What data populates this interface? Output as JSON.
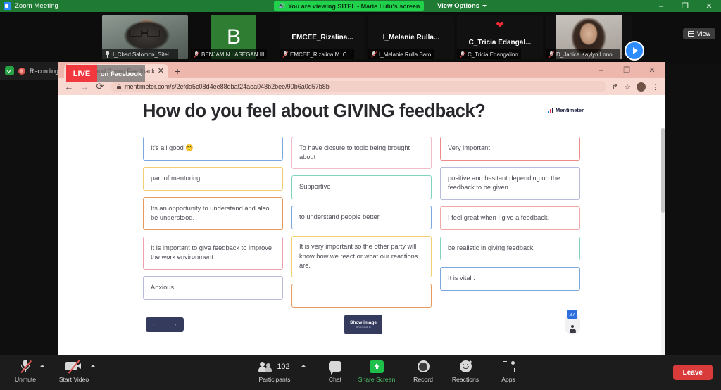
{
  "zoom_titlebar": {
    "app_title": "Zoom Meeting",
    "viewing_banner": "You are viewing SITEL - Marie Lulu's screen",
    "view_options_label": "View Options",
    "minimize": "–",
    "maximize": "❐",
    "close": "✕"
  },
  "filmstrip": {
    "view_button_label": "View",
    "tiles": [
      {
        "name": "I_Chad Salomon_Sitel ...",
        "kind": "video",
        "pinned": true,
        "muted": true,
        "active": true
      },
      {
        "name": "BENJAMIN LASEGAN III",
        "kind": "initial",
        "initial": "B",
        "muted": true,
        "active": false
      },
      {
        "name": "EMCEE_Rizalina M. C...",
        "kind": "text",
        "display": "EMCEE_Rizalina...",
        "muted": true,
        "active": false
      },
      {
        "name": "I_Melanie Rulla Saro",
        "kind": "text",
        "display": "I_Melanie  Rulla...",
        "muted": true,
        "active": false
      },
      {
        "name": "C_Tricia Edangalino",
        "kind": "text",
        "display": "C_Tricia  Edangal...",
        "reaction": "❤",
        "muted": true,
        "active": false
      },
      {
        "name": "D_Janice Kaylyn Lono...",
        "kind": "video",
        "muted": true,
        "active": false
      }
    ]
  },
  "recording_strip": {
    "label": "Recording"
  },
  "live_overlay": {
    "tag": "LIVE",
    "platform": "on Facebook"
  },
  "browser": {
    "tab_title": "...ceiving and Giving Feedback",
    "tab_close": "✕",
    "new_tab": "+",
    "back": "←",
    "forward": "→",
    "reload": "⟳",
    "url": "mentimeter.com/s/2efda5c08d4ee88dbaf24aea048b2bee/90b6a0d57b8b",
    "share_icon": "↱",
    "bookmark_icon": "☆",
    "menu_icon": "⋮",
    "minimize": "–",
    "maximize": "❐",
    "close": "✕"
  },
  "mentimeter": {
    "question": "How do you feel about GIVING feedback?",
    "brand": "Mentimeter",
    "columns": [
      [
        {
          "text": "It's all good 😊",
          "border": "#7ba7dd"
        },
        {
          "text": "part of mentoring",
          "border": "#f0cf72"
        },
        {
          "text": "Its an opportunity to understand and also be understood.",
          "border": "#e99a5e"
        },
        {
          "text": "It is important to give feedback to improve the work environment",
          "border": "#efa2ad"
        },
        {
          "text": "Anxious",
          "border": "#b9bcd8"
        }
      ],
      [
        {
          "text": "To have closure to topic being brought about",
          "border": "#f0bcc6"
        },
        {
          "text": "Supportive",
          "border": "#7fd4c0"
        },
        {
          "text": "to understand people better",
          "border": "#7ba7dd"
        },
        {
          "text": "It is very important so the other party will know how we react or what our reactions are.",
          "border": "#f0cf72"
        },
        {
          "text": "",
          "border": "#e99a5e"
        }
      ],
      [
        {
          "text": "Very important",
          "border": "#ef8a8a"
        },
        {
          "text": "positive and hesitant depending on the feedback to be given",
          "border": "#b9bcd8"
        },
        {
          "text": "I feel great when I give a feedback.",
          "border": "#f0a8a8"
        },
        {
          "text": "be realistic in giving feedback",
          "border": "#7fd4c0"
        },
        {
          "text": "It is vital .",
          "border": "#7ba7dd"
        }
      ]
    ],
    "nav": {
      "prev": "←",
      "next": "→"
    },
    "show_image_button": {
      "label": "Show image",
      "shortcut": "Shortcut S"
    },
    "participant_pod": {
      "count": "27"
    }
  },
  "zoom_toolbar": {
    "items": [
      {
        "id": "unmute",
        "label": "Unmute",
        "has_caret": true,
        "green": false
      },
      {
        "id": "start-video",
        "label": "Start Video",
        "has_caret": true,
        "green": false
      },
      {
        "id": "participants",
        "label": "Participants",
        "count": "102",
        "has_caret": true,
        "green": false
      },
      {
        "id": "chat",
        "label": "Chat",
        "has_caret": false,
        "green": false
      },
      {
        "id": "share-screen",
        "label": "Share Screen",
        "has_caret": false,
        "green": true
      },
      {
        "id": "record",
        "label": "Record",
        "has_caret": false,
        "green": false
      },
      {
        "id": "reactions",
        "label": "Reactions",
        "has_caret": false,
        "green": false
      },
      {
        "id": "apps",
        "label": "Apps",
        "has_caret": false,
        "green": false
      }
    ],
    "leave_label": "Leave"
  },
  "colors": {
    "zoom_green": "#1f7a33",
    "banner_green": "#22d14b",
    "browser_chrome": "#f7d9d2",
    "menti_navy": "#343b5c",
    "leave_red": "#d93b3b",
    "live_red": "#f2383f"
  }
}
